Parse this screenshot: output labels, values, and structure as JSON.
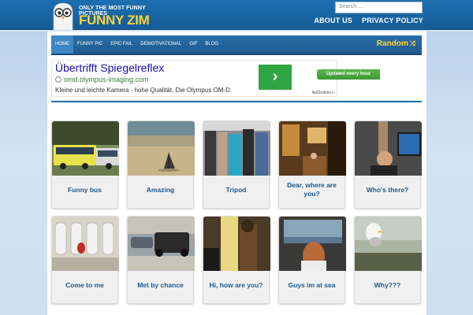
{
  "site": {
    "tagline": "ONLY THE MOST FUNNY PICTURES",
    "name": "FUNNY ZIM",
    "search_placeholder": "Search ...",
    "top_links": [
      "ABOUT US",
      "PRIVACY POLICY"
    ]
  },
  "nav": {
    "items": [
      "HOME",
      "FUNNY PIC",
      "EPIC FAIL",
      "DEMOTIVATIONAL",
      "GIF",
      "BLOG"
    ],
    "active": "HOME",
    "random_label": "Random"
  },
  "ad": {
    "title": "Übertrifft Spiegelreflex",
    "url": "omd.olympus-imaging.com",
    "description": "Kleine und leichte Kamera - hohe Qualität. Die Olympus OM-D.",
    "go_symbol": "›",
    "choices_label": "AdChoices ▷"
  },
  "badge": "Updated every hour",
  "posts": [
    {
      "title": "Funny bus",
      "thumb": "bus"
    },
    {
      "title": "Amazing",
      "thumb": "beach"
    },
    {
      "title": "Tripod",
      "thumb": "crowd"
    },
    {
      "title": "Dear, where are you?",
      "thumb": "room"
    },
    {
      "title": "Who's there?",
      "thumb": "screen"
    },
    {
      "title": "Come to me",
      "thumb": "urinals"
    },
    {
      "title": "Met by chance",
      "thumb": "cars"
    },
    {
      "title": "Hi, how are you?",
      "thumb": "couple"
    },
    {
      "title": "Guys im at sea",
      "thumb": "sea"
    },
    {
      "title": "Why???",
      "thumb": "gull"
    }
  ]
}
